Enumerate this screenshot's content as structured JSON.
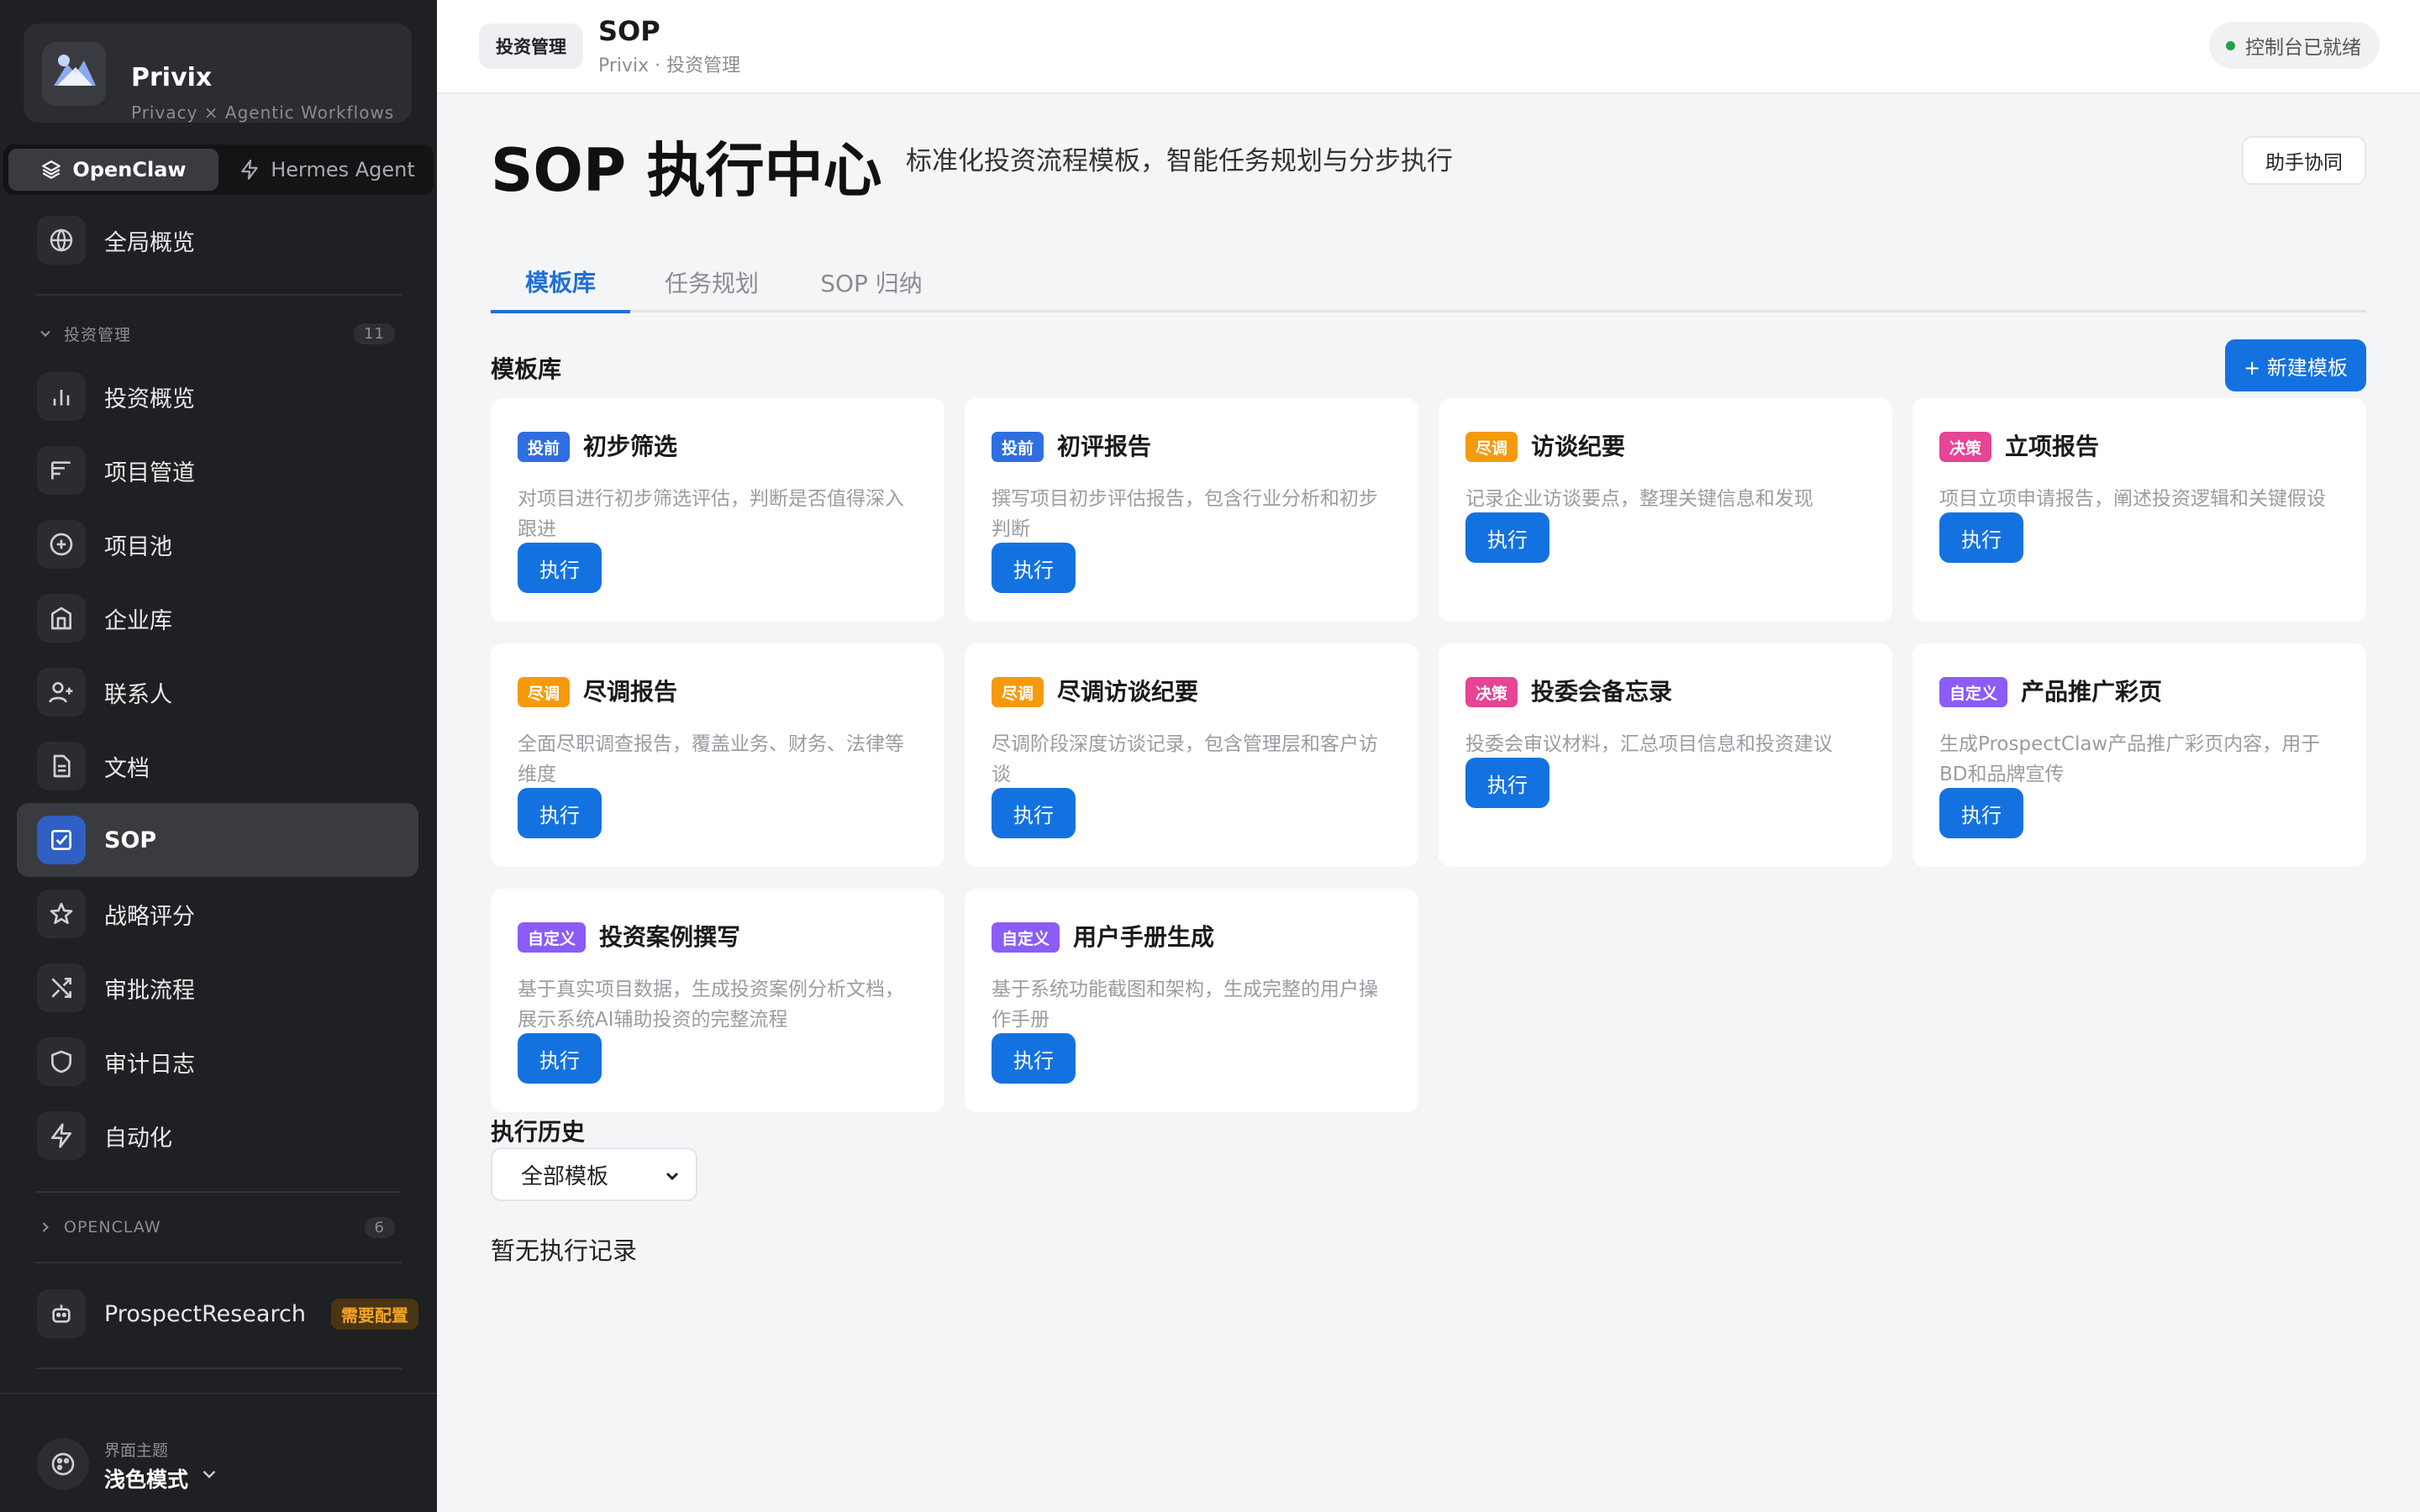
{
  "brand": {
    "name": "Privix",
    "tagline": "Privacy × Agentic Workflows"
  },
  "agents": [
    {
      "label": "OpenClaw",
      "icon": "layers-icon",
      "active": true
    },
    {
      "label": "Hermes Agent",
      "icon": "bolt-icon",
      "active": false
    }
  ],
  "sidebar": {
    "overview": {
      "label": "全局概览",
      "icon": "globe-icon"
    },
    "group1": {
      "label": "投资管理",
      "count": "11"
    },
    "items": [
      {
        "label": "投资概览",
        "icon": "bar-chart-icon"
      },
      {
        "label": "项目管道",
        "icon": "pipeline-icon"
      },
      {
        "label": "项目池",
        "icon": "plus-circle-icon"
      },
      {
        "label": "企业库",
        "icon": "building-icon"
      },
      {
        "label": "联系人",
        "icon": "user-plus-icon"
      },
      {
        "label": "文档",
        "icon": "document-icon"
      },
      {
        "label": "SOP",
        "icon": "checkbox-icon",
        "active": true
      },
      {
        "label": "战略评分",
        "icon": "star-icon"
      },
      {
        "label": "审批流程",
        "icon": "shuffle-icon"
      },
      {
        "label": "审计日志",
        "icon": "shield-icon"
      },
      {
        "label": "自动化",
        "icon": "bolt-icon"
      }
    ],
    "group2": {
      "label": "OPENCLAW",
      "count": "6"
    },
    "prospect": {
      "label": "ProspectResearch",
      "badge": "需要配置",
      "icon": "robot-icon"
    },
    "theme": {
      "label": "界面主题",
      "value": "浅色模式"
    }
  },
  "topbar": {
    "chip": "投资管理",
    "title": "SOP",
    "subtitle": "Privix · 投资管理",
    "status": "控制台已就绪"
  },
  "page": {
    "title": "SOP 执行中心",
    "description": "标准化投资流程模板，智能任务规划与分步执行",
    "assist_button": "助手协同"
  },
  "tabs": [
    "模板库",
    "任务规划",
    "SOP 归纳"
  ],
  "library": {
    "title": "模板库",
    "new_button": "+ 新建模板",
    "run_label": "执行",
    "cards": [
      {
        "tag": "投前",
        "tag_color": "#2f6ee0",
        "title": "初步筛选",
        "desc": "对项目进行初步筛选评估，判断是否值得深入跟进"
      },
      {
        "tag": "投前",
        "tag_color": "#2f6ee0",
        "title": "初评报告",
        "desc": "撰写项目初步评估报告，包含行业分析和初步判断"
      },
      {
        "tag": "尽调",
        "tag_color": "#f59a0b",
        "title": "访谈纪要",
        "desc": "记录企业访谈要点，整理关键信息和发现"
      },
      {
        "tag": "决策",
        "tag_color": "#e64494",
        "title": "立项报告",
        "desc": "项目立项申请报告，阐述投资逻辑和关键假设"
      },
      {
        "tag": "尽调",
        "tag_color": "#f59a0b",
        "title": "尽调报告",
        "desc": "全面尽职调查报告，覆盖业务、财务、法律等维度"
      },
      {
        "tag": "尽调",
        "tag_color": "#f59a0b",
        "title": "尽调访谈纪要",
        "desc": "尽调阶段深度访谈记录，包含管理层和客户访谈"
      },
      {
        "tag": "决策",
        "tag_color": "#e64494",
        "title": "投委会备忘录",
        "desc": "投委会审议材料，汇总项目信息和投资建议"
      },
      {
        "tag": "自定义",
        "tag_color": "#8b5cf6",
        "title": "产品推广彩页",
        "desc": "生成ProspectClaw产品推广彩页内容，用于BD和品牌宣传"
      },
      {
        "tag": "自定义",
        "tag_color": "#8b5cf6",
        "title": "投资案例撰写",
        "desc": "基于真实项目数据，生成投资案例分析文档，展示系统AI辅助投资的完整流程"
      },
      {
        "tag": "自定义",
        "tag_color": "#8b5cf6",
        "title": "用户手册生成",
        "desc": "基于系统功能截图和架构，生成完整的用户操作手册"
      }
    ]
  },
  "history": {
    "title": "执行历史",
    "filter_value": "全部模板",
    "empty": "暂无执行记录"
  }
}
